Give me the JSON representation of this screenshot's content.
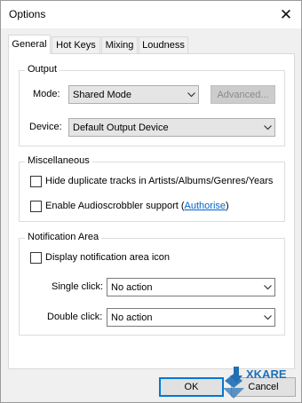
{
  "window": {
    "title": "Options"
  },
  "tabs": [
    {
      "label": "General",
      "active": true
    },
    {
      "label": "Hot Keys",
      "active": false
    },
    {
      "label": "Mixing",
      "active": false
    },
    {
      "label": "Loudness",
      "active": false
    }
  ],
  "output": {
    "legend": "Output",
    "mode_label": "Mode:",
    "mode_value": "Shared Mode",
    "advanced_label": "Advanced...",
    "device_label": "Device:",
    "device_value": "Default Output Device"
  },
  "misc": {
    "legend": "Miscellaneous",
    "hide_duplicates_label": "Hide duplicate tracks in Artists/Albums/Genres/Years",
    "hide_duplicates_checked": false,
    "audioscrobbler_label": "Enable Audioscrobbler support (",
    "authorise_link": "Authorise",
    "audioscrobbler_suffix": ")",
    "audioscrobbler_checked": false
  },
  "notification": {
    "legend": "Notification Area",
    "display_icon_label": "Display notification area icon",
    "display_icon_checked": false,
    "single_click_label": "Single click:",
    "single_click_value": "No action",
    "double_click_label": "Double click:",
    "double_click_value": "No action"
  },
  "footer": {
    "ok_label": "OK",
    "cancel_label": "Cancel"
  },
  "watermark": {
    "text": "XKARE"
  },
  "colors": {
    "accent": "#0078d7",
    "link": "#0066cc",
    "watermark_blue": "#1f6fb5"
  }
}
